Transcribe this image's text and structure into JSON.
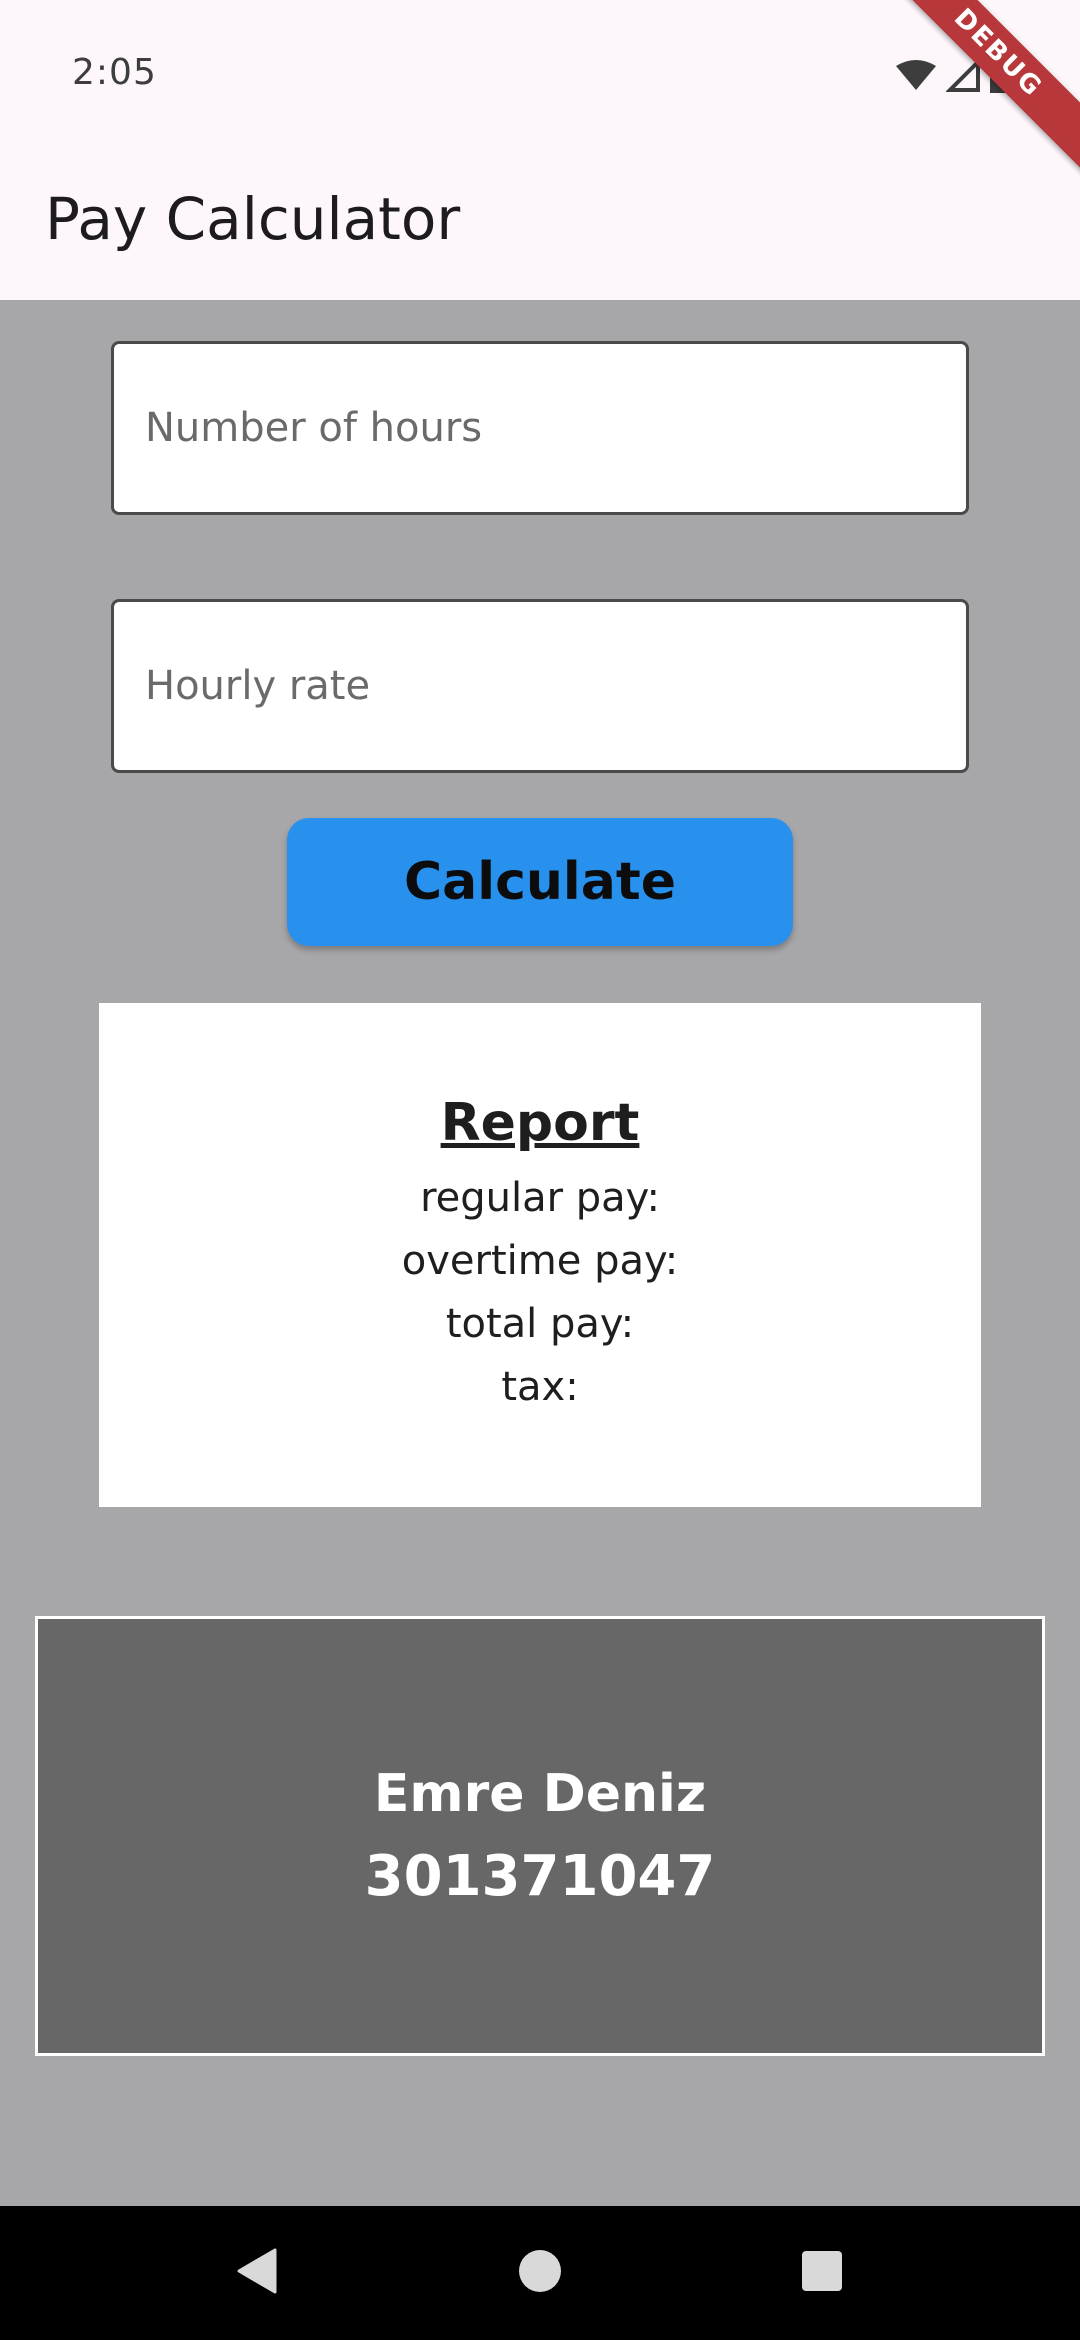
{
  "status_bar": {
    "time": "2:05",
    "icons": [
      "wifi-icon",
      "signal-icon",
      "battery-icon"
    ],
    "debug_label": "DEBUG"
  },
  "app_bar": {
    "title": "Pay Calculator"
  },
  "form": {
    "hours_placeholder": "Number of hours",
    "hours_value": "",
    "rate_placeholder": "Hourly rate",
    "rate_value": "",
    "calculate_label": "Calculate"
  },
  "report": {
    "title": "Report",
    "regular_pay": "regular pay:",
    "overtime_pay": "overtime pay:",
    "total_pay": "total pay:",
    "tax": "tax:"
  },
  "footer": {
    "name": "Emre Deniz",
    "student_id": "301371047"
  },
  "nav_bar": {
    "icons": [
      "back-icon",
      "home-icon",
      "recents-icon"
    ]
  },
  "colors": {
    "background": "#a7a6a8",
    "app_bar": "#fdf7fc",
    "button": "#2891ee",
    "footer_card": "#676767",
    "debug_ribbon": "#b7373a"
  }
}
